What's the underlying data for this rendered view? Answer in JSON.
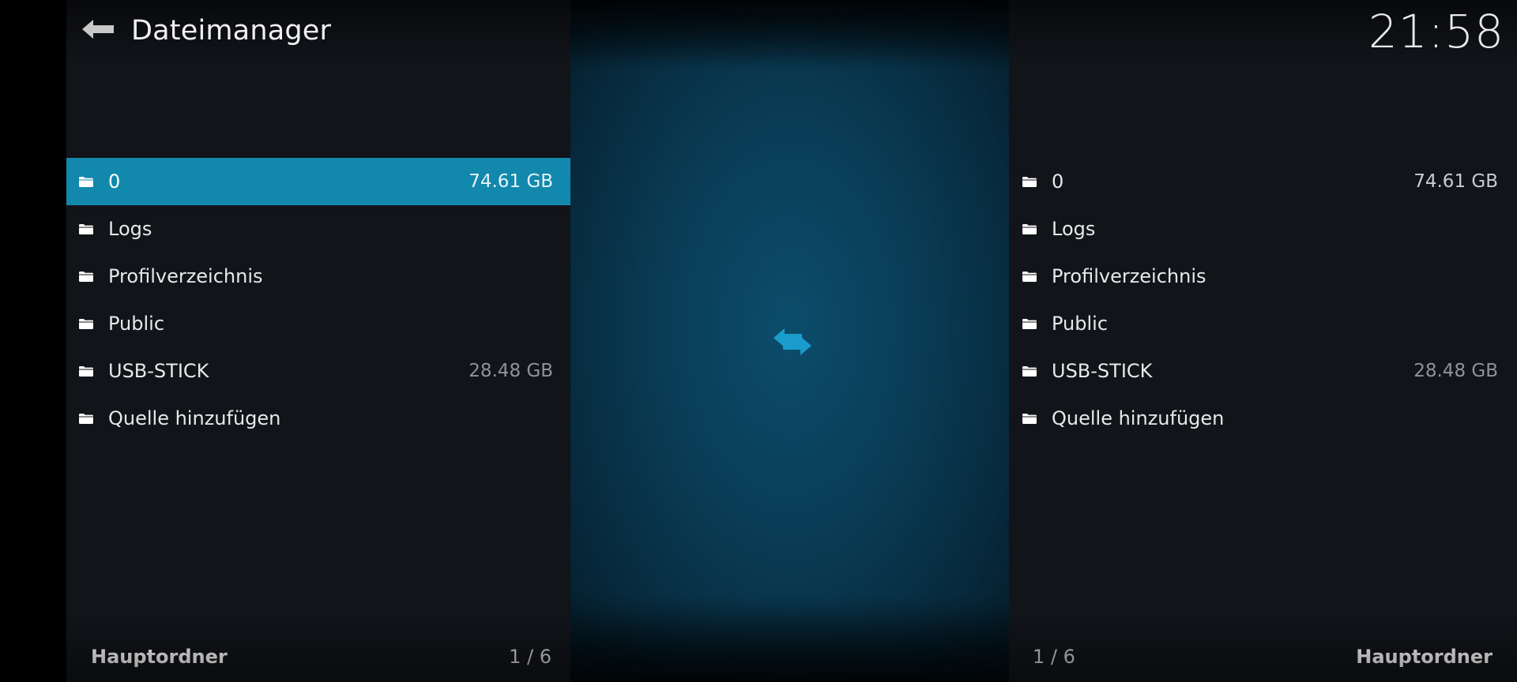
{
  "header": {
    "title": "Dateimanager",
    "clock": "21:58"
  },
  "left_panel": {
    "items": [
      {
        "name": "0",
        "size": "74.61 GB",
        "selected": true
      },
      {
        "name": "Logs",
        "size": ""
      },
      {
        "name": "Profilverzeichnis",
        "size": ""
      },
      {
        "name": "Public",
        "size": ""
      },
      {
        "name": "USB-STICK",
        "size": "28.48 GB"
      },
      {
        "name": "Quelle hinzufügen",
        "size": ""
      }
    ],
    "footer_label": "Hauptordner",
    "footer_count": "1 / 6"
  },
  "right_panel": {
    "items": [
      {
        "name": "0",
        "size": "74.61 GB"
      },
      {
        "name": "Logs",
        "size": ""
      },
      {
        "name": "Profilverzeichnis",
        "size": ""
      },
      {
        "name": "Public",
        "size": ""
      },
      {
        "name": "USB-STICK",
        "size": "28.48 GB"
      },
      {
        "name": "Quelle hinzufügen",
        "size": ""
      }
    ],
    "footer_label": "Hauptordner",
    "footer_count": "1 / 6"
  },
  "icons": {
    "back": "back-arrow-icon",
    "folder": "folder-icon",
    "swap": "swap-arrows-icon"
  },
  "colors": {
    "accent": "#1188ac",
    "swap_icon": "#1a9ccc",
    "panel_bg": "#111419"
  }
}
